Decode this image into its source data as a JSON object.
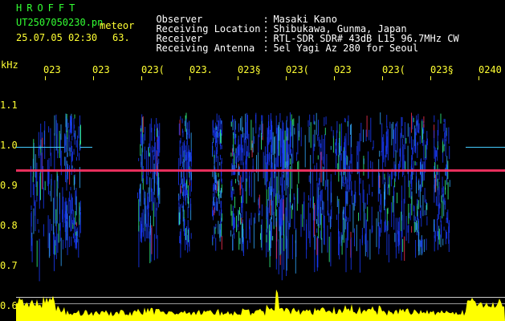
{
  "header": {
    "title": "HROFFT",
    "filename": "UT2507050230.pn",
    "meteor_label": "meteor",
    "datetime": "25.07.05 02:30",
    "count": "63.",
    "info": [
      {
        "key": "Observer",
        "value": "Masaki Kano"
      },
      {
        "key": "Receiving Location",
        "value": "Shibukawa, Gunma, Japan"
      },
      {
        "key": "Receiver",
        "value": "RTL-SDR SDR# 43dB L15 96.7MHz CW"
      },
      {
        "key": "Receiving Antenna",
        "value": "5el Yagi Az 280 for Seoul"
      }
    ]
  },
  "axis": {
    "y_unit": "kHz",
    "y_ticks": [
      "1.1",
      "1.0",
      "0.9",
      "0.8",
      "0.7",
      "0.6"
    ],
    "x_ticks": [
      "023",
      "023",
      "023(",
      "023.",
      "023§",
      "023(",
      "023",
      "023(",
      "023§",
      "0240"
    ]
  },
  "colors": {
    "background": "#000000",
    "header_green": "#33ff33",
    "header_yellow": "#ffff33",
    "header_white": "#ffffff",
    "band_line": "#ff3366",
    "level_fill": "#ffff00",
    "noise_blue": "#1a3cff"
  }
}
